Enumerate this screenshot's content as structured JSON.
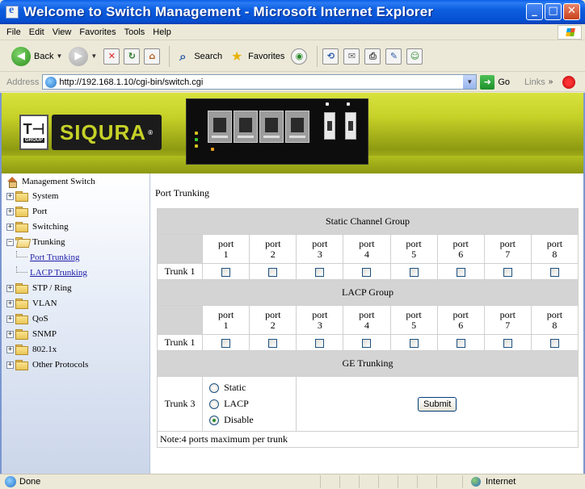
{
  "window": {
    "title": "Welcome to Switch Management - Microsoft Internet Explorer"
  },
  "menu": {
    "items": [
      "File",
      "Edit",
      "View",
      "Favorites",
      "Tools",
      "Help"
    ]
  },
  "toolbar": {
    "back_label": "Back",
    "search_label": "Search",
    "favorites_label": "Favorites"
  },
  "address": {
    "label": "Address",
    "url": "http://192.168.1.10/cgi-bin/switch.cgi",
    "go_label": "Go",
    "links_label": "Links"
  },
  "banner": {
    "logo_th": "T⊣",
    "logo_group": "GROUP",
    "logo_brand": "SIQURA"
  },
  "sidebar": {
    "root": "Management Switch",
    "items": [
      "System",
      "Port",
      "Switching",
      "Trunking",
      "STP / Ring",
      "VLAN",
      "QoS",
      "SNMP",
      "802.1x",
      "Other Protocols"
    ],
    "trunking_children": [
      "Port Trunking",
      "LACP Trunking"
    ]
  },
  "main": {
    "page_title": "Port Trunking",
    "static_group_header": "Static Channel Group",
    "lacp_group_header": "LACP Group",
    "ge_header": "GE Trunking",
    "port_word": "port",
    "ports": [
      "1",
      "2",
      "3",
      "4",
      "5",
      "6",
      "7",
      "8"
    ],
    "trunk1_label": "Trunk 1",
    "trunk3_label": "Trunk 3",
    "ge_options": [
      "Static",
      "LACP",
      "Disable"
    ],
    "ge_selected": "Disable",
    "submit_label": "Submit",
    "note": "Note:4 ports maximum per trunk"
  },
  "status": {
    "left": "Done",
    "zone": "Internet"
  },
  "colors": {
    "banner": "#c6d128",
    "header_cell": "#d4d4d4",
    "link": "#1c1ca8"
  }
}
